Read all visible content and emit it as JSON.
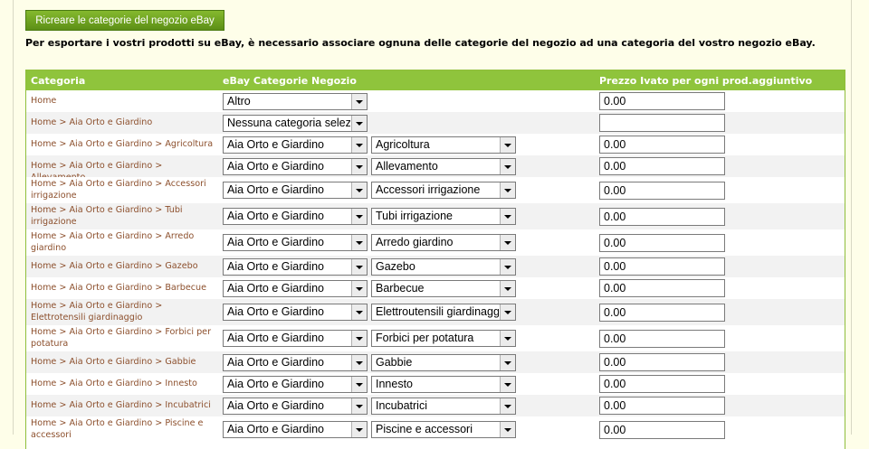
{
  "rebuild_button": "Ricreare le categorie del negozio eBay",
  "intro_text": "Per esportare i vostri prodotti su eBay, è necessario associare ognuna delle categorie del negozio ad una categoria del vostro negozio eBay.",
  "columns": {
    "category": "Categoria",
    "ebay_category": "eBay Categorie Negozio",
    "price": "Prezzo Ivato per ogni prod.aggiuntivo"
  },
  "rows": [
    {
      "category": "Home",
      "main": "Altro",
      "sub": null,
      "price": "0.00"
    },
    {
      "category": "Home > Aia Orto e Giardino",
      "main": "Nessuna categoria selezionata",
      "sub": null,
      "price": ""
    },
    {
      "category": "Home > Aia Orto e Giardino > Agricoltura",
      "main": "Aia Orto e Giardino",
      "sub": "Agricoltura",
      "price": "0.00"
    },
    {
      "category": "Home > Aia Orto e Giardino > Allevamento",
      "main": "Aia Orto e Giardino",
      "sub": "Allevamento",
      "price": "0.00"
    },
    {
      "category": "Home > Aia Orto e Giardino > Accessori irrigazione",
      "main": "Aia Orto e Giardino",
      "sub": "Accessori irrigazione",
      "price": "0.00"
    },
    {
      "category": "Home > Aia Orto e Giardino > Tubi irrigazione",
      "main": "Aia Orto e Giardino",
      "sub": "Tubi irrigazione",
      "price": "0.00"
    },
    {
      "category": "Home > Aia Orto e Giardino > Arredo giardino",
      "main": "Aia Orto e Giardino",
      "sub": "Arredo giardino",
      "price": "0.00"
    },
    {
      "category": "Home > Aia Orto e Giardino > Gazebo",
      "main": "Aia Orto e Giardino",
      "sub": "Gazebo",
      "price": "0.00"
    },
    {
      "category": "Home > Aia Orto e Giardino > Barbecue",
      "main": "Aia Orto e Giardino",
      "sub": "Barbecue",
      "price": "0.00"
    },
    {
      "category": "Home > Aia Orto e Giardino > Elettrotensili giardinaggio",
      "main": "Aia Orto e Giardino",
      "sub": "Elettroutensili giardinaggio",
      "price": "0.00"
    },
    {
      "category": "Home > Aia Orto e Giardino > Forbici per potatura",
      "main": "Aia Orto e Giardino",
      "sub": "Forbici per potatura",
      "price": "0.00"
    },
    {
      "category": "Home > Aia Orto e Giardino > Gabbie",
      "main": "Aia Orto e Giardino",
      "sub": "Gabbie",
      "price": "0.00"
    },
    {
      "category": "Home > Aia Orto e Giardino > Innesto",
      "main": "Aia Orto e Giardino",
      "sub": "Innesto",
      "price": "0.00"
    },
    {
      "category": "Home > Aia Orto e Giardino > Incubatrici",
      "main": "Aia Orto e Giardino",
      "sub": "Incubatrici",
      "price": "0.00"
    },
    {
      "category": "Home > Aia Orto e Giardino > Piscine e accessori",
      "main": "Aia Orto e Giardino",
      "sub": "Piscine e accessori",
      "price": "0.00"
    }
  ],
  "icons": {
    "dropdown": "chevron-down-icon"
  }
}
